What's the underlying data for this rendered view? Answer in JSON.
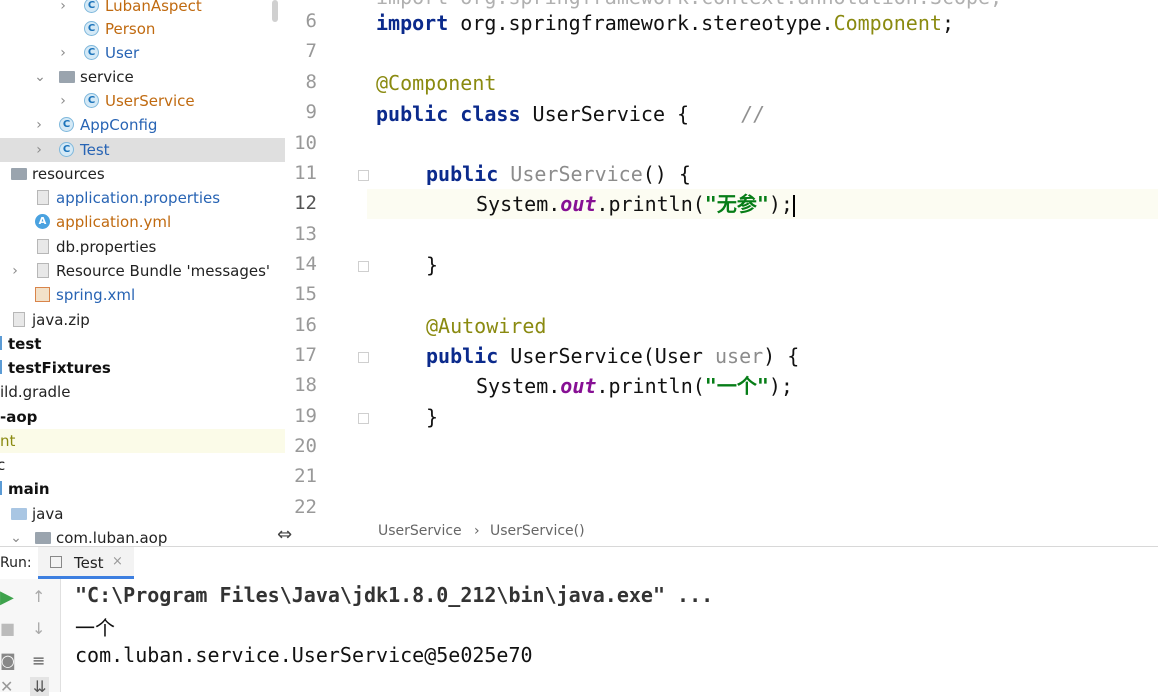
{
  "project_tree": {
    "items": [
      {
        "label": "LubanAspect",
        "icon": "class-icon"
      },
      {
        "label": "Person",
        "icon": "class-icon"
      },
      {
        "label": "User",
        "icon": "class-icon"
      },
      {
        "label": "service",
        "icon": "package-icon"
      },
      {
        "label": "UserService",
        "icon": "class-icon"
      },
      {
        "label": "AppConfig",
        "icon": "class-icon"
      },
      {
        "label": "Test",
        "icon": "runnable-class-icon"
      },
      {
        "label": "resources",
        "icon": "resources-folder-icon"
      },
      {
        "label": "application.properties",
        "icon": "properties-file-icon"
      },
      {
        "label": "application.yml",
        "icon": "yml-file-icon"
      },
      {
        "label": "db.properties",
        "icon": "properties-file-icon"
      },
      {
        "label": "Resource Bundle 'messages'",
        "icon": "resource-bundle-icon"
      },
      {
        "label": "spring.xml",
        "icon": "xml-file-icon"
      },
      {
        "label": "java.zip",
        "icon": "zip-file-icon"
      },
      {
        "label": "test",
        "icon": "folder-icon"
      },
      {
        "label": "testFixtures",
        "icon": "folder-icon"
      },
      {
        "label": "ild.gradle",
        "icon": "gradle-file-icon"
      },
      {
        "label": "-aop",
        "icon": "module-icon"
      },
      {
        "label": "nt",
        "icon": "none"
      },
      {
        "label": "c",
        "icon": "none"
      },
      {
        "label": "main",
        "icon": "folder-icon"
      },
      {
        "label": "java",
        "icon": "folder-icon"
      },
      {
        "label": "com.luban.aop",
        "icon": "package-icon"
      }
    ]
  },
  "editor": {
    "line_numbers": [
      "6",
      "7",
      "8",
      "9",
      "10",
      "11",
      "12",
      "13",
      "14",
      "15",
      "16",
      "17",
      "18",
      "19",
      "20",
      "21",
      "22"
    ],
    "current_line": "12",
    "lines": {
      "l5_partial": "import org.springframework.context.annotation.Scope;",
      "l6_import": "import",
      "l6_pkg": " org.springframework.stereotype.",
      "l6_cls": "Component",
      "l6_semi": ";",
      "l8_ann": "@Component",
      "l9_public": "public",
      "l9_class": " class",
      "l9_name": " UserService {",
      "l9_comment": "//",
      "l11_public": "public",
      "l11_ctor": " UserService",
      "l11_rest": "() {",
      "l12_sys": "System.",
      "l12_out": "out",
      "l12_println": ".println(",
      "l12_str": "\"无参\"",
      "l12_end": ");",
      "l14_close": "}",
      "l16_ann": "@Autowired",
      "l17_public": "public",
      "l17_ctor": " UserService(User ",
      "l17_param": "user",
      "l17_end": ") {",
      "l18_sys": "System.",
      "l18_out": "out",
      "l18_println": ".println(",
      "l18_str": "\"一个\"",
      "l18_end": ");",
      "l19_close": "}"
    }
  },
  "breadcrumb": {
    "class_name": "UserService",
    "separator": "›",
    "method_name": "UserService()"
  },
  "run_panel": {
    "label": "Run:",
    "tab_label": "Test",
    "tab_close": "×",
    "output": [
      "\"C:\\Program Files\\Java\\jdk1.8.0_212\\bin\\java.exe\" ...",
      "一个",
      "com.luban.service.UserService@5e025e70"
    ]
  },
  "colors": {
    "keyword": "#0b2a8c",
    "annotation": "#8a8a10",
    "string": "#067d17",
    "static_field": "#871094",
    "selected_row": "#dfdfdf",
    "active_tab_underline": "#3d7fe0"
  }
}
